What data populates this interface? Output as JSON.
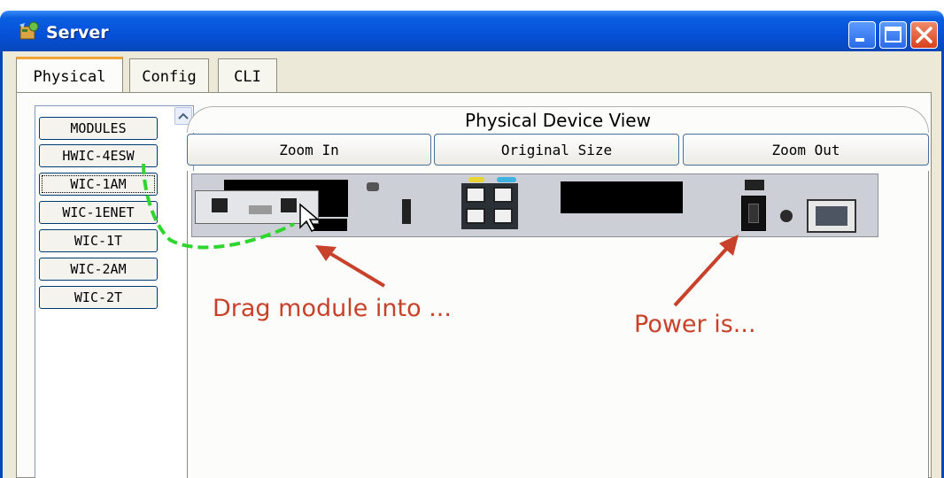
{
  "window": {
    "title": "Server"
  },
  "tabs": [
    {
      "label": "Physical",
      "active": true
    },
    {
      "label": "Config",
      "active": false
    },
    {
      "label": "CLI",
      "active": false
    }
  ],
  "modules": {
    "items": [
      "MODULES",
      "HWIC-4ESW",
      "WIC-1AM",
      "WIC-1ENET",
      "WIC-1T",
      "WIC-2AM",
      "WIC-2T"
    ],
    "selected": "WIC-1AM"
  },
  "device_view": {
    "title": "Physical Device View",
    "zoom_in_label": "Zoom In",
    "original_size_label": "Original Size",
    "zoom_out_label": "Zoom Out"
  },
  "annotations": {
    "drag": "Drag module into ...",
    "power": "Power is..."
  },
  "colors": {
    "titlebar": "#0550d8",
    "annotation": "#c8412a",
    "drag_path": "#2ed62e"
  },
  "icons": [
    "server-icon",
    "minimize-icon",
    "maximize-icon",
    "close-icon",
    "scroll-up-icon",
    "cursor-icon"
  ]
}
